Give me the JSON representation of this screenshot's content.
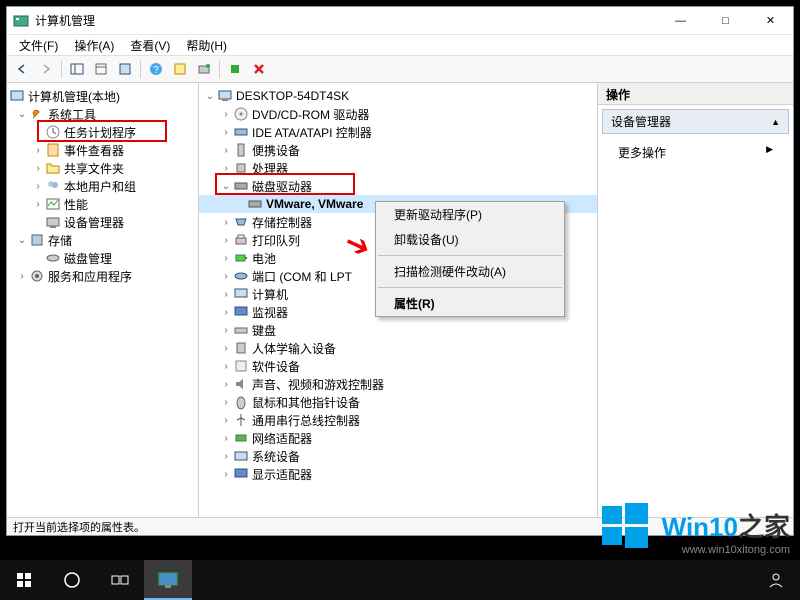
{
  "window": {
    "title": "计算机管理",
    "minimize": "—",
    "maximize": "□",
    "close": "✕"
  },
  "menubar": {
    "file": "文件(F)",
    "action": "操作(A)",
    "view": "查看(V)",
    "help": "帮助(H)"
  },
  "left_tree": {
    "root": "计算机管理(本地)",
    "system_tools": "系统工具",
    "task_scheduler": "任务计划程序",
    "event_viewer": "事件查看器",
    "shared_folders": "共享文件夹",
    "local_users": "本地用户和组",
    "performance": "性能",
    "device_manager": "设备管理器",
    "storage": "存储",
    "disk_mgmt": "磁盘管理",
    "services_apps": "服务和应用程序"
  },
  "mid_tree": {
    "root": "DESKTOP-54DT4SK",
    "dvd": "DVD/CD-ROM 驱动器",
    "ide": "IDE ATA/ATAPI 控制器",
    "portable": "便携设备",
    "cpu": "处理器",
    "disk_drives": "磁盘驱动器",
    "vmware_disk": "VMware, VMware",
    "storage_ctrl": "存储控制器",
    "print_queue": "打印队列",
    "battery": "电池",
    "ports": "端口 (COM 和 LPT",
    "computer": "计算机",
    "monitor": "监视器",
    "keyboard": "键盘",
    "hid": "人体学输入设备",
    "software": "软件设备",
    "sound": "声音、视频和游戏控制器",
    "mouse": "鼠标和其他指针设备",
    "usb": "通用串行总线控制器",
    "network": "网络适配器",
    "system": "系统设备",
    "display": "显示适配器"
  },
  "context_menu": {
    "update": "更新驱动程序(P)",
    "uninstall": "卸载设备(U)",
    "scan": "扫描检测硬件改动(A)",
    "properties": "属性(R)"
  },
  "right_pane": {
    "header": "操作",
    "section": "设备管理器",
    "more": "更多操作",
    "arrow": "▲",
    "caret": "▶"
  },
  "statusbar": "打开当前选择项的属性表。",
  "watermark": {
    "brand_a": "Win10",
    "brand_b": "之家",
    "url": "www.win10xitong.com"
  }
}
